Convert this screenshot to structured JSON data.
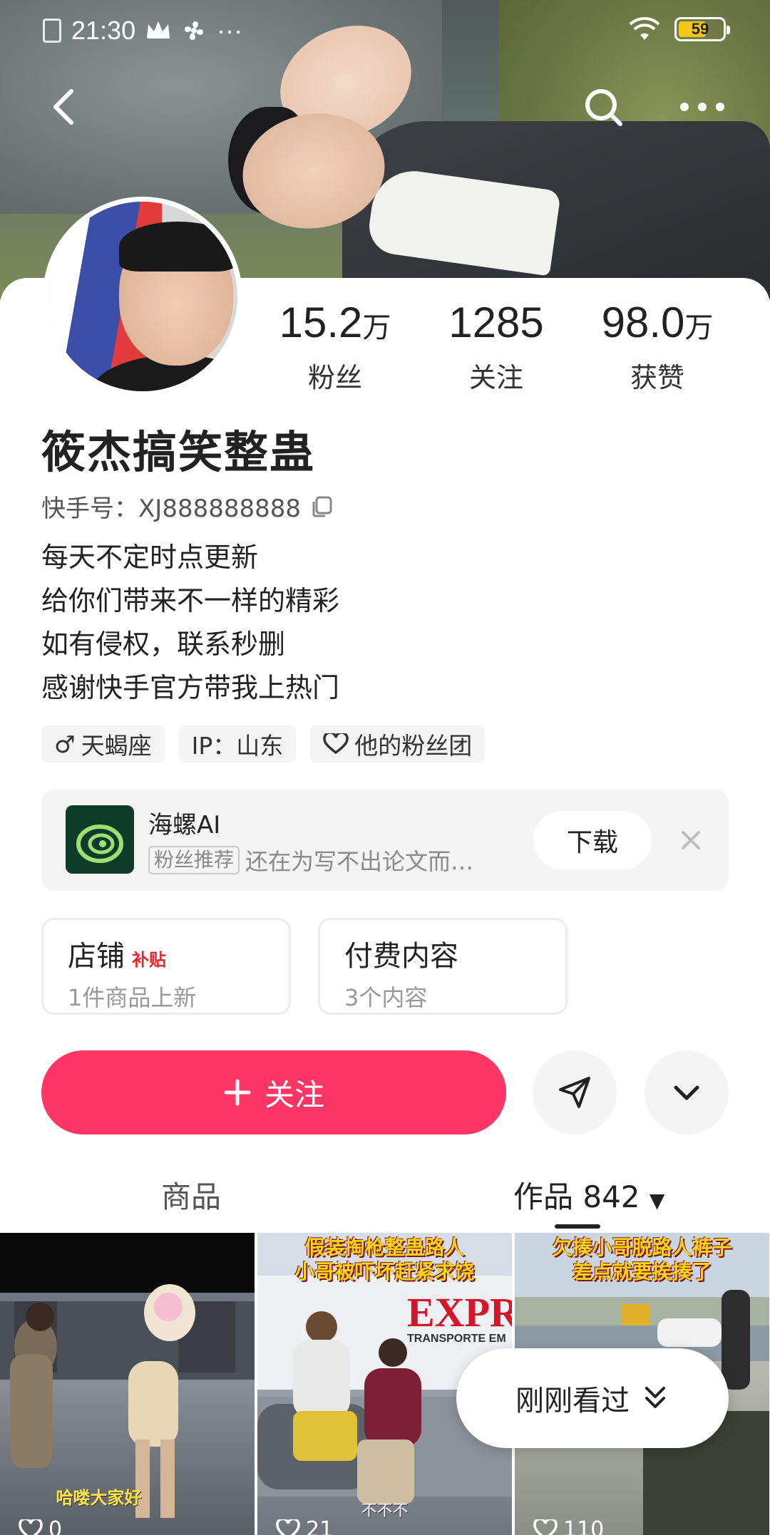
{
  "status_bar": {
    "time": "21:30",
    "dots": "···",
    "battery": "59"
  },
  "profile": {
    "name": "筱杰搞笑整蛊",
    "kuaishou_id": "快手号：XJ888888888",
    "stats": [
      {
        "value": "15.2",
        "unit": "万",
        "label": "粉丝"
      },
      {
        "value": "1285",
        "unit": "",
        "label": "关注"
      },
      {
        "value": "98.0",
        "unit": "万",
        "label": "获赞"
      }
    ],
    "bio": [
      "每天不定时点更新",
      "给你们带来不一样的精彩",
      "如有侵权，联系秒删",
      "感谢快手官方带我上热门"
    ],
    "tags": {
      "gender_sign": "♂",
      "zodiac": "天蝎座",
      "ip": "IP：山东",
      "fan_group": "他的粉丝团"
    }
  },
  "ad": {
    "title": "海螺AI",
    "badge": "粉丝推荐",
    "text": "还在为写不出论文而…",
    "download": "下载"
  },
  "tiles": [
    {
      "title": "店铺",
      "badge": "补贴",
      "sub": "1件商品上新"
    },
    {
      "title": "付费内容",
      "badge": "",
      "sub": "3个内容"
    }
  ],
  "actions": {
    "follow": "关注"
  },
  "tabs": {
    "goods": "商品",
    "works": "作品 842",
    "works_arrow": "▼"
  },
  "videos": [
    {
      "caption": "",
      "subtitle": "哈喽大家好",
      "likes": "0"
    },
    {
      "caption_l1": "假装掏枪整蛊路人",
      "caption_l2": "小哥被吓坏赶紧求饶",
      "scene_text": "EXPR",
      "scene_sub": "TRANSPORTE EM",
      "subtitle": "不不不",
      "likes": "21"
    },
    {
      "caption_l1": "欠揍小哥脱路人裤子",
      "caption_l2": "差点就要挨揍了",
      "likes": "110"
    }
  ],
  "recent": {
    "label": "刚刚看过"
  },
  "colors": {
    "accent": "#fe3666",
    "tab_active": "#222222"
  }
}
